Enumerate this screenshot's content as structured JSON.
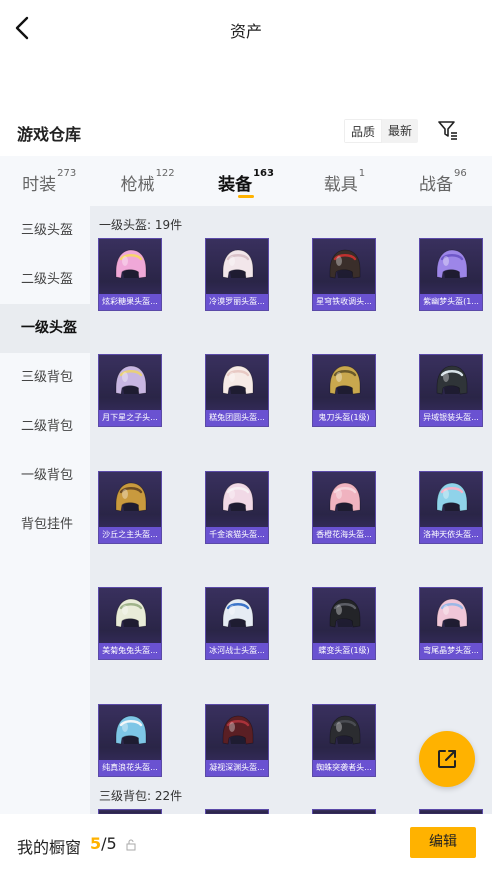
{
  "header": {
    "title": "资产"
  },
  "section": {
    "title": "游戏仓库"
  },
  "sort": {
    "options": [
      "品质",
      "最新"
    ]
  },
  "tabs": [
    {
      "label": "时装",
      "count": "273"
    },
    {
      "label": "枪械",
      "count": "122"
    },
    {
      "label": "装备",
      "count": "163"
    },
    {
      "label": "载具",
      "count": "1"
    },
    {
      "label": "战备",
      "count": "96"
    }
  ],
  "sidebar": {
    "items": [
      "三级头盔",
      "二级头盔",
      "一级头盔",
      "三级背包",
      "二级背包",
      "一级背包",
      "背包挂件"
    ]
  },
  "groups": [
    {
      "label": "一级头盔: 19件"
    },
    {
      "label": "三级背包: 22件"
    }
  ],
  "items": [
    {
      "name": "炫彩糖果头盔...",
      "color": "#f0a8d8",
      "accent": "#f7d46b"
    },
    {
      "name": "冷漠罗丽头盔...",
      "color": "#f2e6ea",
      "accent": "#d9c2c8"
    },
    {
      "name": "星穹铁收调头...",
      "color": "#3a2e2a",
      "accent": "#c0312f"
    },
    {
      "name": "紫幽梦头盔(1...",
      "color": "#9d86e8",
      "accent": "#6f58c9"
    },
    {
      "name": "月下星之子头...",
      "color": "#c8b6e2",
      "accent": "#e8d07a"
    },
    {
      "name": "糕兔团圆头盔...",
      "color": "#f6eae6",
      "accent": "#e8c9c4"
    },
    {
      "name": "鬼刀头盔(1级)",
      "color": "#c9a84e",
      "accent": "#6b5a2a"
    },
    {
      "name": "异域银装头盔...",
      "color": "#2f3438",
      "accent": "#d9e4ea"
    },
    {
      "name": "沙丘之主头盔...",
      "color": "#c99a3e",
      "accent": "#6b4a22"
    },
    {
      "name": "千金滚猫头盔...",
      "color": "#f1d9e6",
      "accent": "#f7f0f3"
    },
    {
      "name": "香橙花海头盔...",
      "color": "#f0b3c0",
      "accent": "#f7d5dc"
    },
    {
      "name": "洛神天依头盔...",
      "color": "#8fd3ea",
      "accent": "#f5b3c8"
    },
    {
      "name": "美菊兔兔头盔...",
      "color": "#e9ecd9",
      "accent": "#9fb38a"
    },
    {
      "name": "冰河战士头盔...",
      "color": "#e6ecf4",
      "accent": "#3b74c9"
    },
    {
      "name": "蝶变头盔(1级)",
      "color": "#232428",
      "accent": "#5c5e66"
    },
    {
      "name": "弯尾晶梦头盔...",
      "color": "#f0c6d8",
      "accent": "#9ab7e6"
    },
    {
      "name": "纯真浪花头盔...",
      "color": "#7ec6e6",
      "accent": "#f2f6f8"
    },
    {
      "name": "凝视深渊头盔...",
      "color": "#5a1f24",
      "accent": "#a8323a"
    },
    {
      "name": "蜘蛛突袭者头...",
      "color": "#2b2c30",
      "accent": "#4a4c52"
    }
  ],
  "bottom": {
    "showcase_label": "我的橱窗",
    "current": "5",
    "total": "/5",
    "edit_label": "编辑"
  }
}
